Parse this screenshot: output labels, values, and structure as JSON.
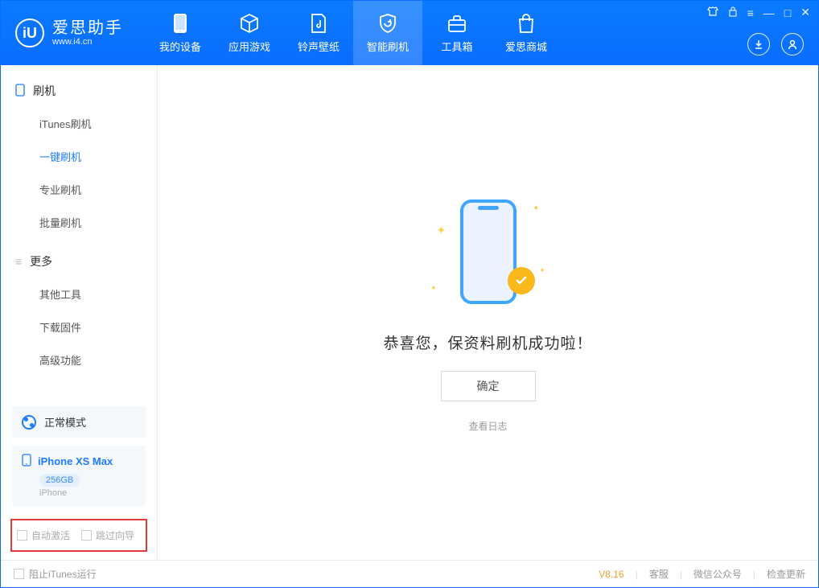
{
  "app": {
    "name": "爱思助手",
    "url": "www.i4.cn"
  },
  "topTabs": [
    {
      "label": "我的设备"
    },
    {
      "label": "应用游戏"
    },
    {
      "label": "铃声壁纸"
    },
    {
      "label": "智能刷机"
    },
    {
      "label": "工具箱"
    },
    {
      "label": "爱思商城"
    }
  ],
  "sidebar": {
    "section1": {
      "title": "刷机"
    },
    "items1": [
      {
        "label": "iTunes刷机"
      },
      {
        "label": "一键刷机"
      },
      {
        "label": "专业刷机"
      },
      {
        "label": "批量刷机"
      }
    ],
    "section2": {
      "title": "更多"
    },
    "items2": [
      {
        "label": "其他工具"
      },
      {
        "label": "下载固件"
      },
      {
        "label": "高级功能"
      }
    ]
  },
  "mode": {
    "label": "正常模式"
  },
  "device": {
    "name": "iPhone XS Max",
    "storage": "256GB",
    "type": "iPhone"
  },
  "options": {
    "autoActivate": "自动激活",
    "skipWizard": "跳过向导"
  },
  "main": {
    "success": "恭喜您，保资料刷机成功啦！",
    "ok": "确定",
    "viewLog": "查看日志"
  },
  "footer": {
    "blockItunes": "阻止iTunes运行",
    "version": "V8.16",
    "support": "客服",
    "wechat": "微信公众号",
    "checkUpdate": "检查更新"
  }
}
